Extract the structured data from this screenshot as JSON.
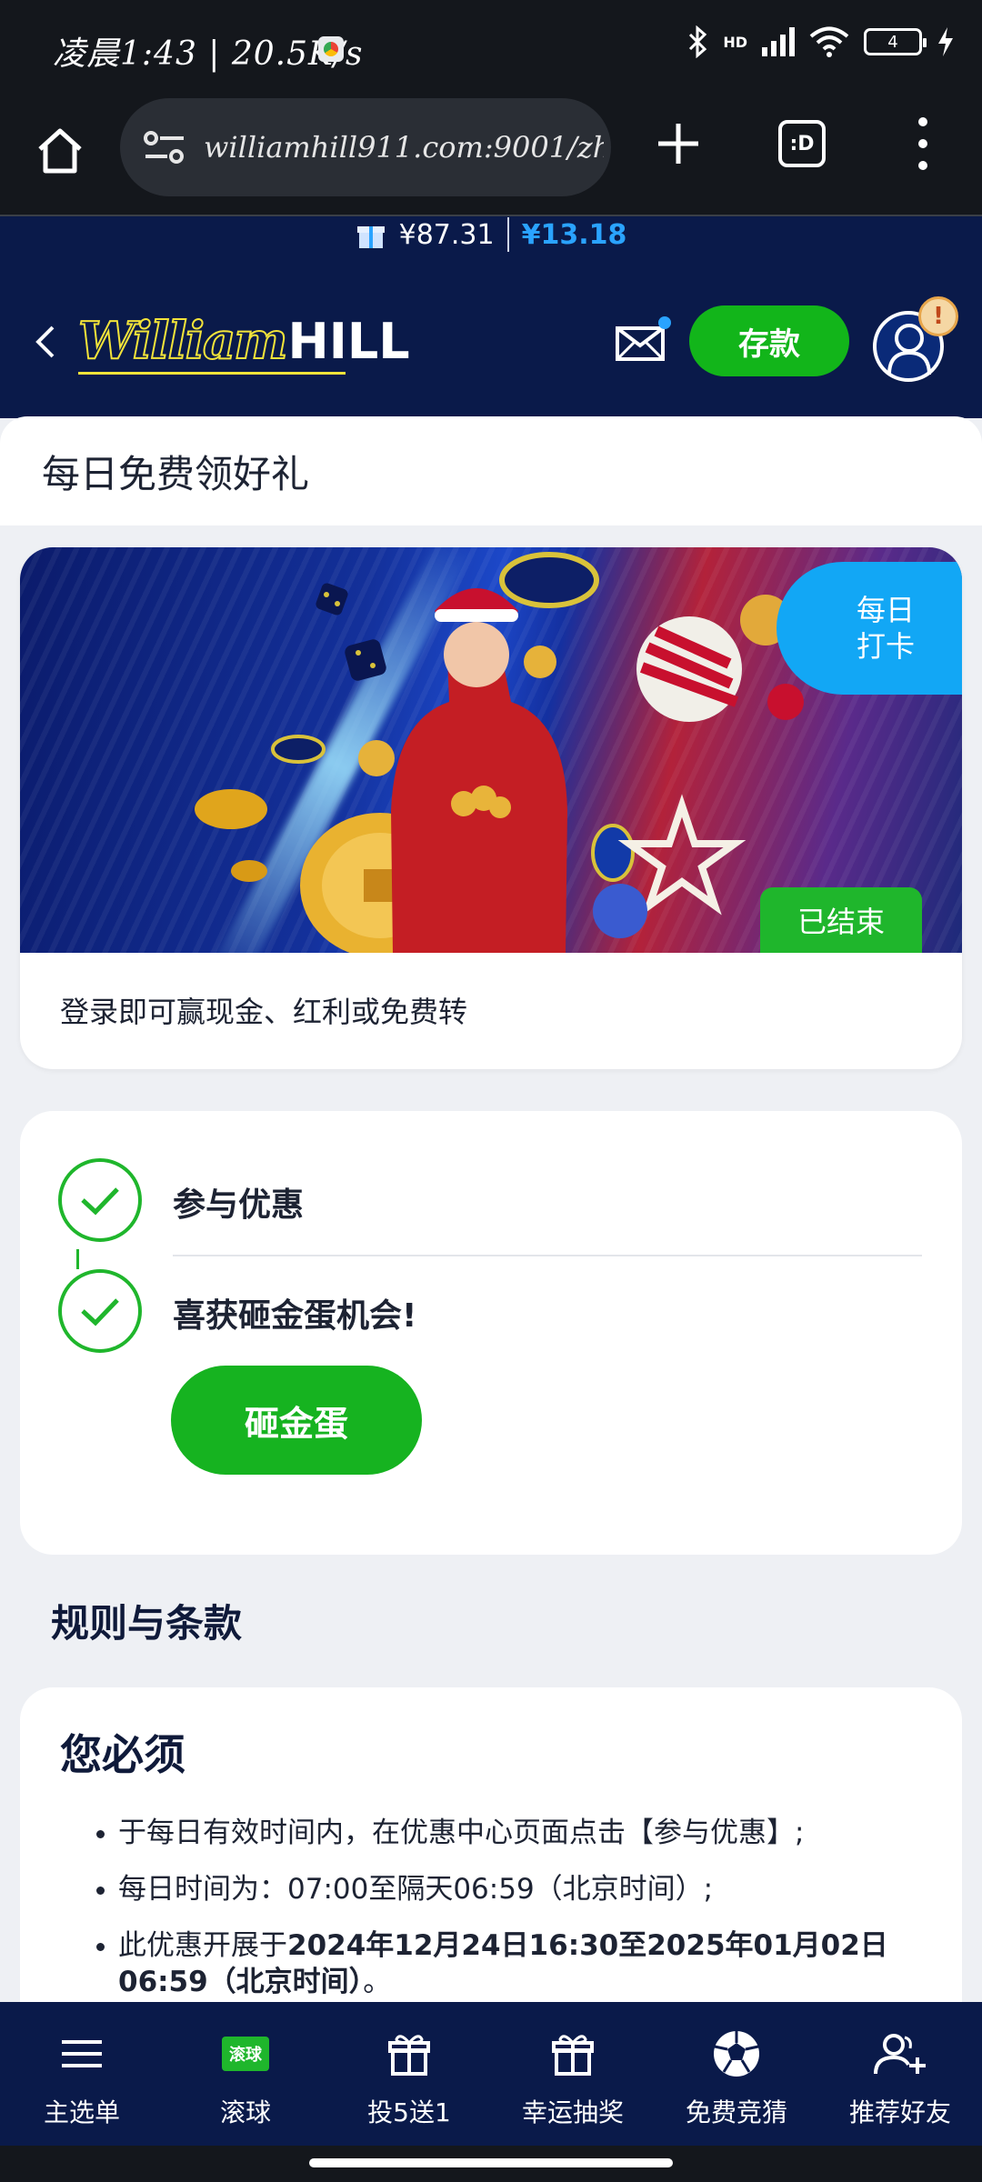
{
  "statusbar": {
    "time": "凌晨1:43 | 20.5K/s",
    "network": "HD",
    "battery": "4"
  },
  "browser": {
    "url": "williamhill911.com:9001/zh-c",
    "tabs_label": ":D"
  },
  "header": {
    "balance_main": "¥87.31",
    "balance_bonus": "¥13.18",
    "logo_script": "William",
    "logo_bold": "HILL",
    "deposit_label": "存款",
    "alert_mark": "!"
  },
  "page": {
    "title": "每日免费领好礼"
  },
  "promo": {
    "daily_tag_line1": "每日",
    "daily_tag_line2": "打卡",
    "ended_tag": "已结束",
    "description": "登录即可赢现金、红利或免费转"
  },
  "steps": {
    "step1": "参与优惠",
    "step2": "喜获砸金蛋机会!",
    "egg_button": "砸金蛋"
  },
  "rules": {
    "section_title": "规则与条款",
    "heading": "您必须",
    "item1": "于每日有效时间内，在优惠中心页面点击【参与优惠】;",
    "item2": "每日时间为：07:00至隔天06:59（北京时间）;",
    "item3_prefix": "此优惠开展于",
    "item3_bold": "2024年12月24日16:30至2025年01月02日06:59（北京时间）",
    "item3_suffix": "。"
  },
  "bottomnav": {
    "items": [
      {
        "label": "主选单",
        "icon": "menu-icon"
      },
      {
        "label": "滚球",
        "icon": "live-badge",
        "badge": "滚球"
      },
      {
        "label": "投5送1",
        "icon": "gift-icon"
      },
      {
        "label": "幸运抽奖",
        "icon": "gift-icon"
      },
      {
        "label": "免费竞猜",
        "icon": "soccer-ball-icon"
      },
      {
        "label": "推荐好友",
        "icon": "add-friend-icon"
      }
    ]
  },
  "colors": {
    "navy": "#0a1a4a",
    "green": "#1fb62c",
    "blue_accent": "#12a7f5",
    "logo_yellow": "#f2e33a"
  }
}
